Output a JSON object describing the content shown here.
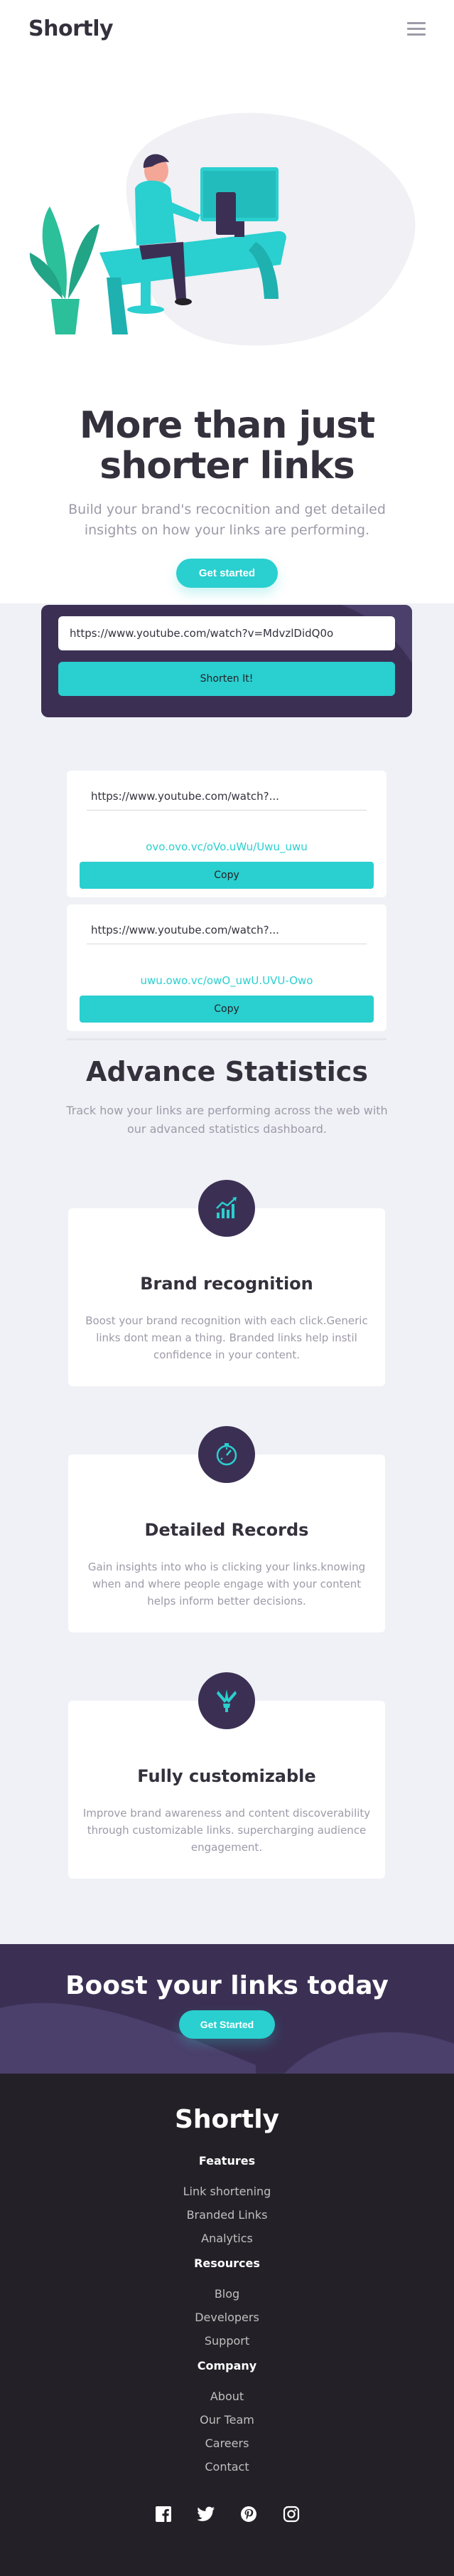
{
  "brand": {
    "logo": "Shortly"
  },
  "header": {
    "menu_icon": "hamburger-menu-icon"
  },
  "hero": {
    "title_line1": "More than just",
    "title_line2": "shorter links",
    "subtitle": "Build your brand's recocnition and get detailed insights on how your links are performing.",
    "cta": "Get started"
  },
  "shorten": {
    "input_value": "https://www.youtube.com/watch?v=MdvzlDidQ0o",
    "button": "Shorten It!"
  },
  "results": [
    {
      "original": "https://www.youtube.com/watch?...",
      "short": "ovo.ovo.vc/oVo.uWu/Uwu_uwu",
      "copy": "Copy"
    },
    {
      "original": "https://www.youtube.com/watch?...",
      "short": "uwu.owo.vc/owO_uwU.UVU-Owo",
      "copy": "Copy"
    }
  ],
  "stats": {
    "title": "Advance Statistics",
    "subtitle": "Track how your links are performing across the web with our advanced statistics dashboard.",
    "features": [
      {
        "icon": "chart-icon",
        "title": "Brand recognition",
        "text": "Boost your brand recognition with each click.Generic links dont mean a thing. Branded links help instil confidence in your content."
      },
      {
        "icon": "gauge-icon",
        "title": "Detailed Records",
        "text": "Gain insights into who is clicking your links.knowing when and where people engage with your content helps inform better decisions."
      },
      {
        "icon": "brush-icon",
        "title": "Fully customizable",
        "text": "Improve brand awareness and content discoverability through customizable links. supercharging audience engagement."
      }
    ]
  },
  "boost": {
    "title": "Boost your links today",
    "cta": "Get Started"
  },
  "footer": {
    "logo": "Shortly",
    "columns": [
      {
        "title": "Features",
        "links": [
          "Link shortening",
          "Branded Links",
          "Analytics"
        ]
      },
      {
        "title": "Resources",
        "links": [
          "Blog",
          "Developers",
          "Support"
        ]
      },
      {
        "title": "Company",
        "links": [
          "About",
          "Our Team",
          "Careers",
          "Contact"
        ]
      }
    ],
    "socials": [
      "facebook-icon",
      "twitter-icon",
      "pinterest-icon",
      "instagram-icon"
    ]
  },
  "colors": {
    "cyan": "#2acfcf",
    "dark_violet": "#3b3054",
    "very_dark": "#232127",
    "gray": "#9e9aa8",
    "background": "#f0f1f6"
  }
}
